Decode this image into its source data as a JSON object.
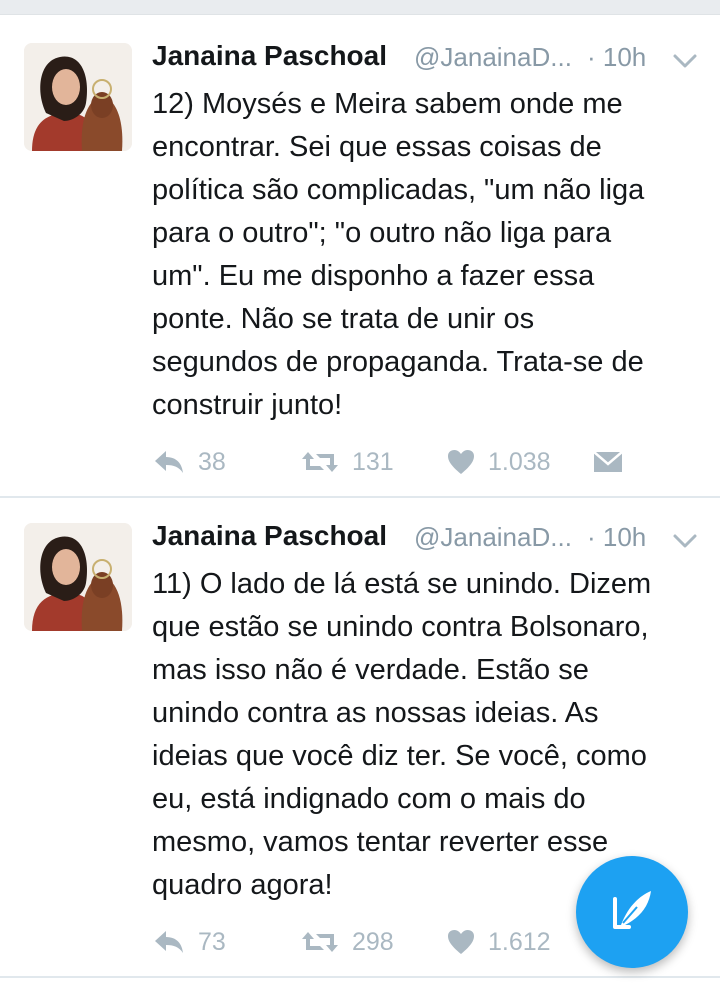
{
  "tweets": [
    {
      "name": "Janaina Paschoal",
      "handle": "@JanainaD...",
      "time": "· 10h",
      "text": "12) Moysés e Meira sabem onde me\nencontrar. Sei que essas coisas de\npolítica são complicadas, \"um não liga\npara o outro\"; \"o outro não liga para\num\". Eu me disponho a fazer essa\nponte. Não se trata de unir os\nsegundos de propaganda. Trata-se de\nconstruir junto!",
      "replies": "38",
      "retweets": "131",
      "likes": "1.038"
    },
    {
      "name": "Janaina Paschoal",
      "handle": "@JanainaD...",
      "time": "· 10h",
      "text": "11) O lado de lá está se unindo. Dizem\nque estão se unindo contra Bolsonaro,\nmas isso não é verdade. Estão se\nunindo contra as nossas ideias. As\nideias que você diz ter. Se você, como\neu, está indignado com o mais do\nmesmo, vamos tentar reverter esse\nquadro agora!",
      "replies": "73",
      "retweets": "298",
      "likes": "1.612"
    }
  ],
  "icons": {
    "reply": "reply-icon",
    "retweet": "retweet-icon",
    "like": "heart-icon",
    "dm": "envelope-icon",
    "more": "chevron-down-icon",
    "compose": "compose-quill-icon"
  },
  "colors": {
    "accent": "#1da1f2",
    "muted": "#aab8c2",
    "text": "#14171a",
    "secondary": "#8899a6"
  }
}
